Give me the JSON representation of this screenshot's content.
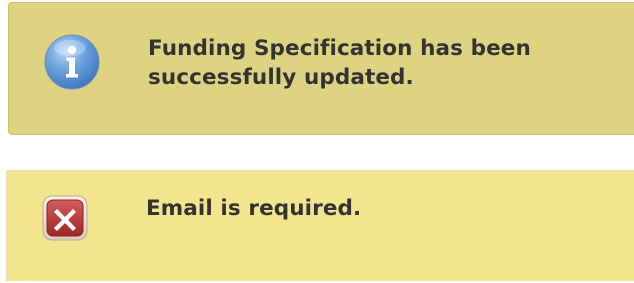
{
  "messages": {
    "info": {
      "icon": "info-icon",
      "text": "Funding Specification has been successfully updated.",
      "background_color": "#ded381",
      "icon_color": "#4a88cf"
    },
    "error": {
      "icon": "error-close-icon",
      "text": "Email is required.",
      "background_color": "#f3e48e",
      "icon_color": "#b83a3a"
    }
  }
}
